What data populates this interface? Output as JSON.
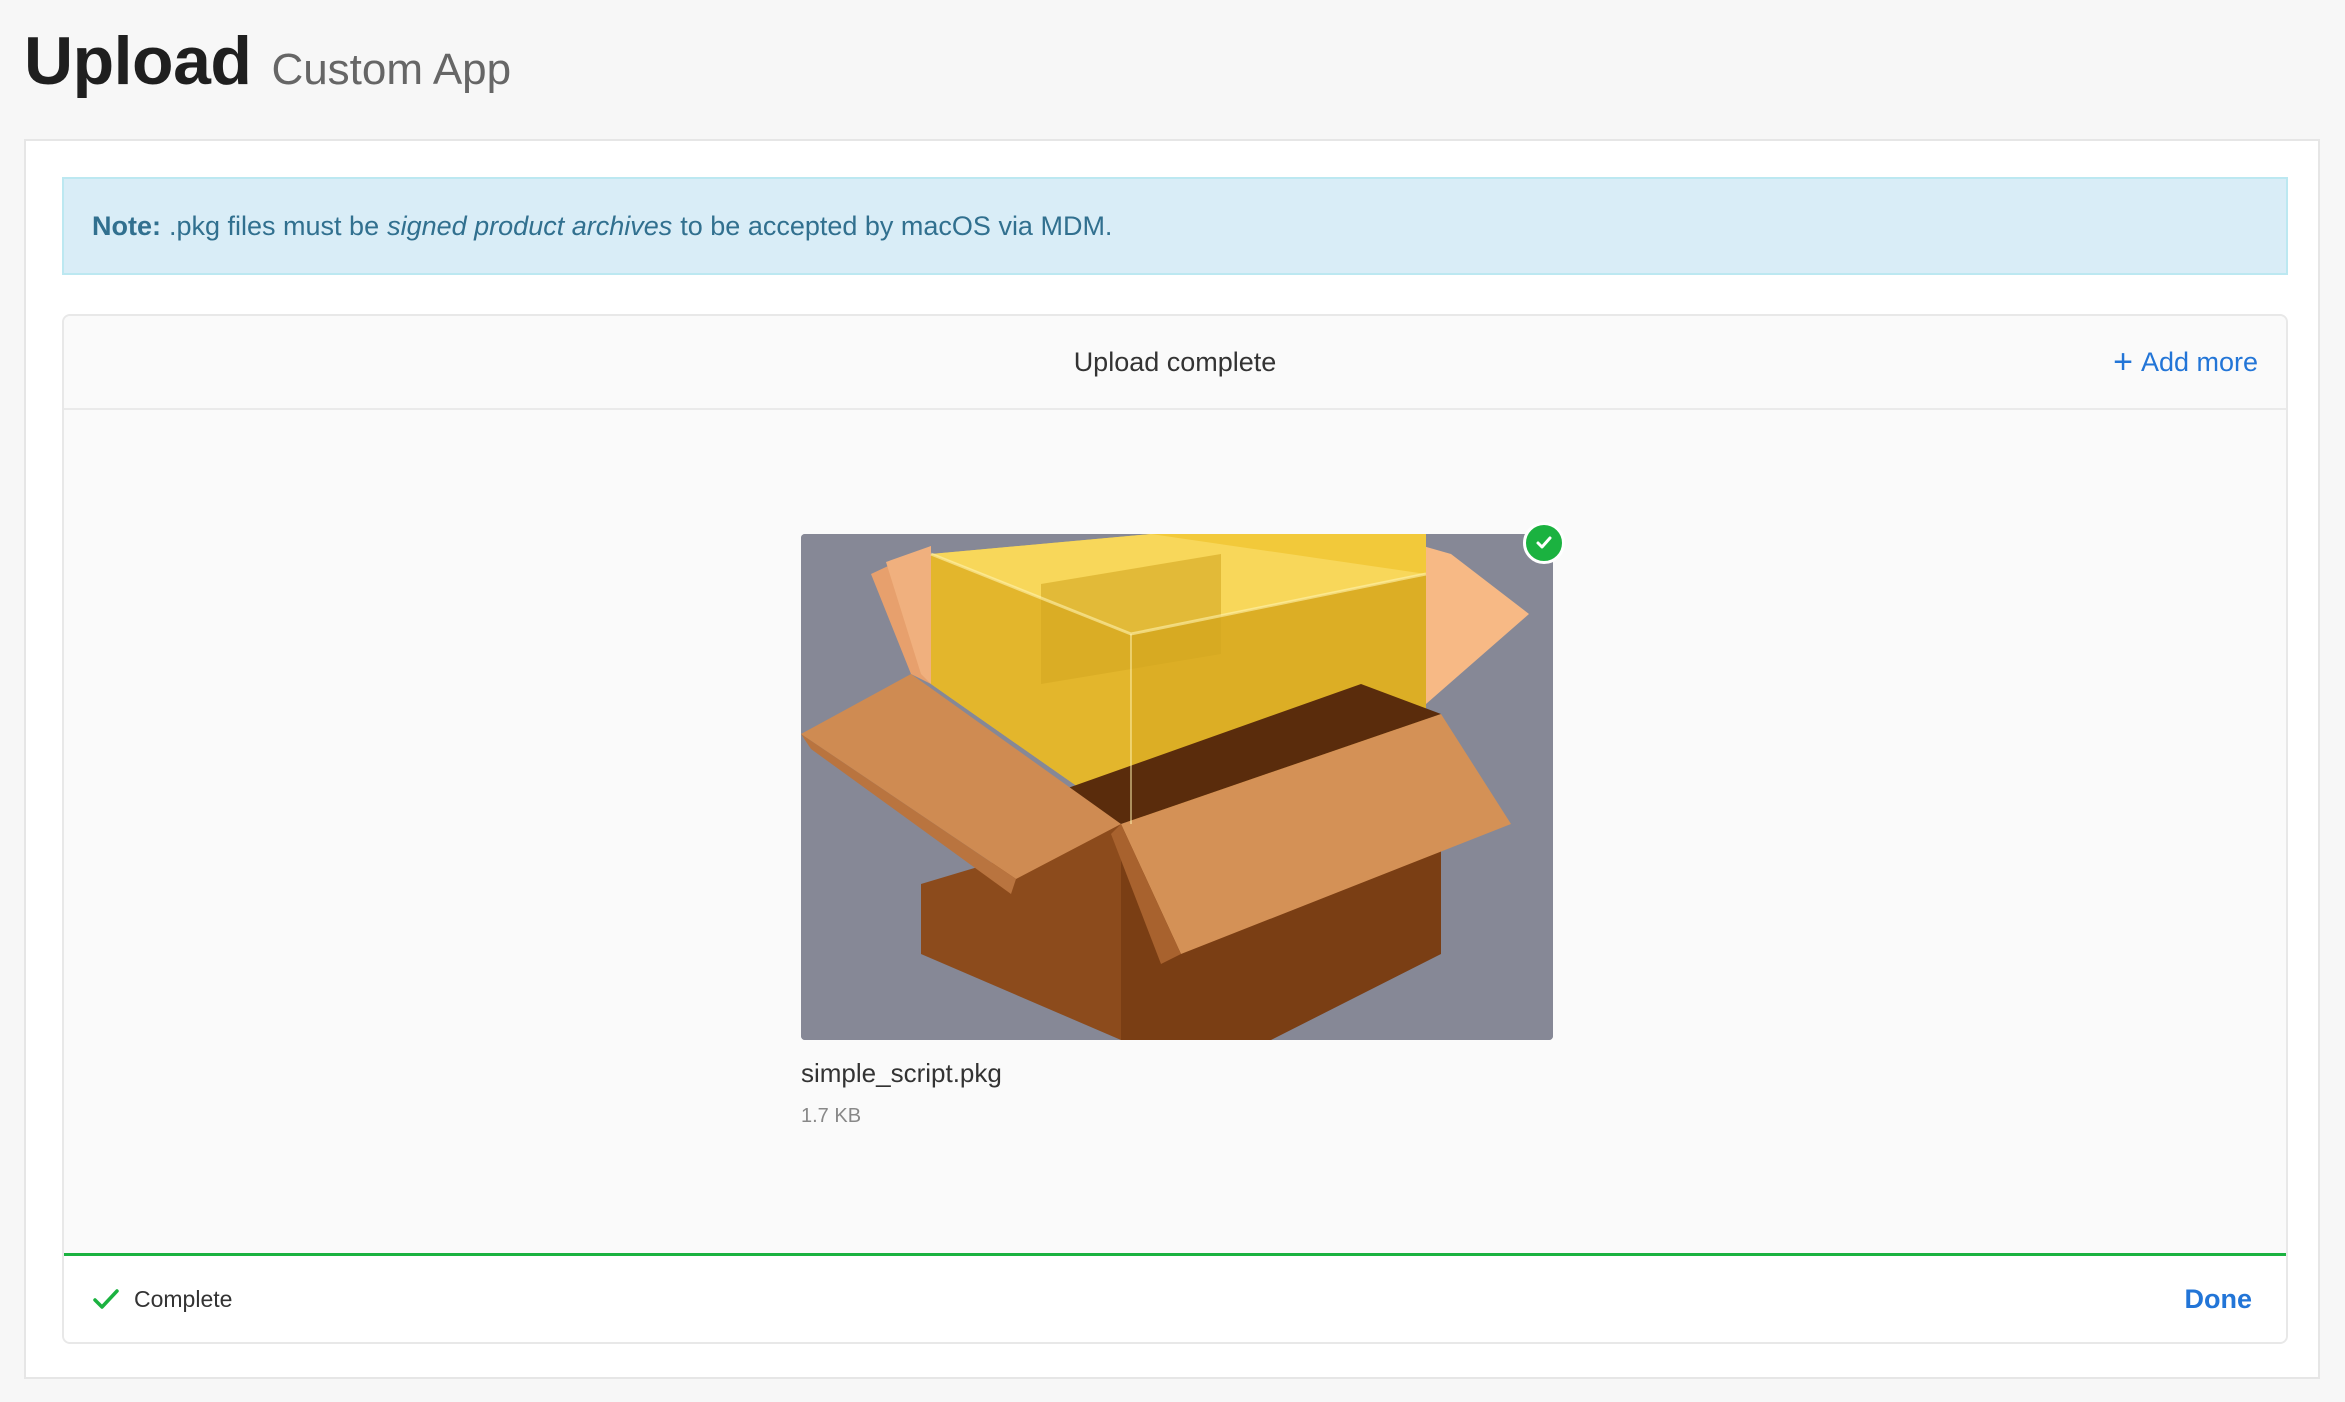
{
  "header": {
    "title": "Upload",
    "subtitle": "Custom App"
  },
  "note": {
    "label": "Note:",
    "text_before": ".pkg files must be",
    "emphasis": "signed product archives",
    "text_after": "to be accepted by macOS via MDM."
  },
  "uploader": {
    "status": "Upload complete",
    "add_more_label": "Add more",
    "file": {
      "name": "simple_script.pkg",
      "size": "1.7 KB"
    },
    "footer": {
      "status_label": "Complete",
      "done_label": "Done"
    }
  },
  "icons": {
    "add": "plus-icon",
    "success_badge": "check-circle-icon",
    "complete": "check-icon",
    "thumbnail": "package-box-icon"
  },
  "colors": {
    "accent": "#2275d7",
    "success": "#1bb240",
    "note_background": "#d9edf7",
    "note_text": "#31708f"
  }
}
